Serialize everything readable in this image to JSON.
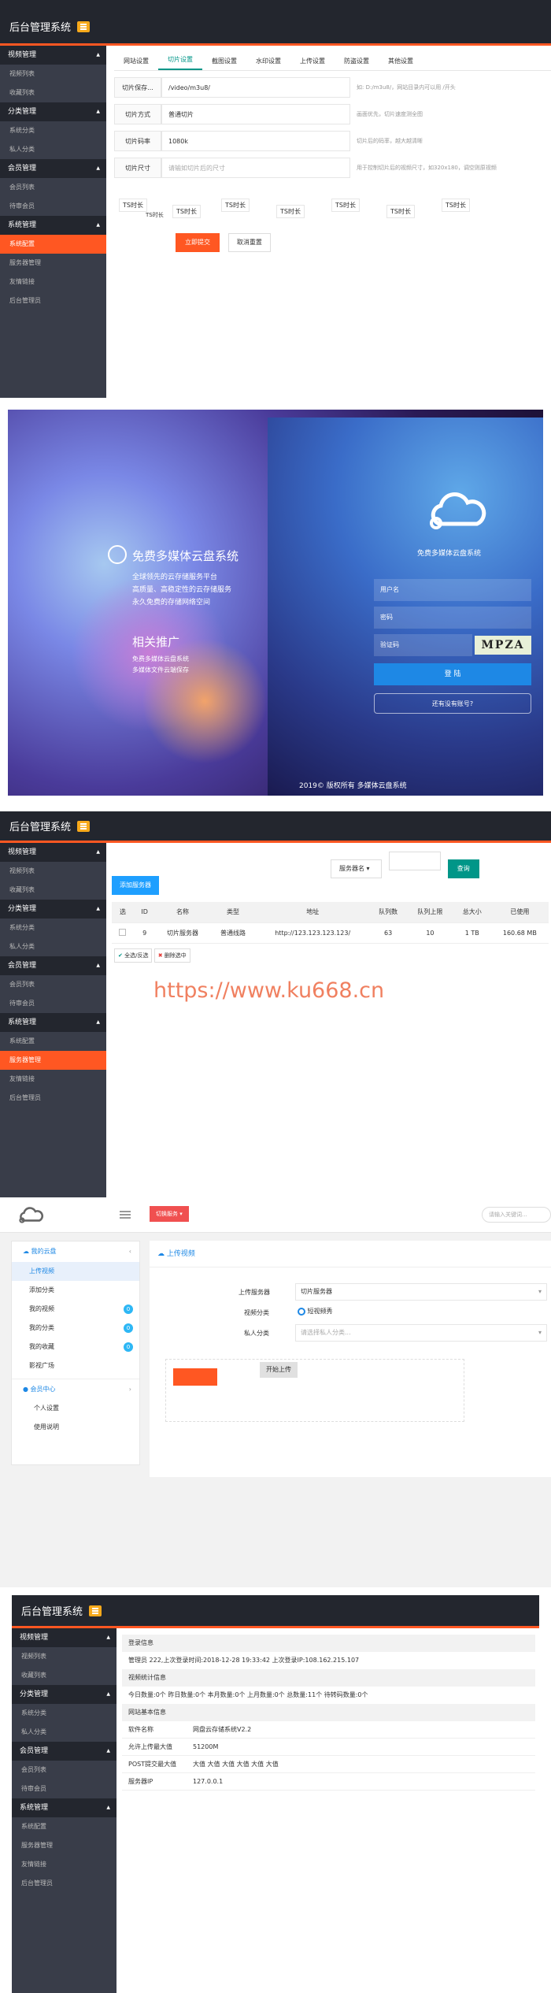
{
  "s1": {
    "title": "后台管理系统",
    "sidebar": [
      {
        "g": "视频管理",
        "items": [
          "视频列表",
          "收藏列表"
        ]
      },
      {
        "g": "分类管理",
        "items": [
          "系统分类",
          "私人分类"
        ]
      },
      {
        "g": "会员管理",
        "items": [
          "会员列表",
          "待审会员"
        ]
      },
      {
        "g": "系统管理",
        "items": [
          "系统配置",
          "服务器管理",
          "友情链接",
          "后台管理员"
        ]
      }
    ],
    "active_item": "系统配置",
    "tabs": [
      "网站设置",
      "切片设置",
      "截图设置",
      "水印设置",
      "上传设置",
      "防盗设置",
      "其他设置"
    ],
    "active_tab": "切片设置",
    "rows": [
      {
        "label": "切片保存...",
        "value": "/video/m3u8/",
        "hint": "如: D:/m3u8/，网站目录内可以用 /开头"
      },
      {
        "label": "切片方式",
        "value": "普通切片",
        "hint": "画面优先，切片速度测全图"
      },
      {
        "label": "切片码率",
        "value": "1080k",
        "hint": "切片后的码率，越大越清晰"
      },
      {
        "label": "切片尺寸",
        "value": "",
        "placeholder": "请输如切片后的尺寸",
        "hint": "用于控制切片后的视频尺寸，如320x180，调空则原视频"
      }
    ],
    "ts_labels": [
      "TS时长",
      "TS时长",
      "TS时长",
      "TS时长",
      "TS时长",
      "TS时长",
      "TS时长"
    ],
    "ts_top": "TS时长",
    "submit": "立即提交",
    "reset": "取消重置"
  },
  "s2": {
    "heading": "免费多媒体云盘系统",
    "lines": [
      "全球领先的云存储服务平台",
      "高质量、高稳定性的云存储服务",
      "永久免费的存储网络空间"
    ],
    "promo_title": "相关推广",
    "promo_lines": [
      "免费多媒体云盘系统",
      "多媒体文件云端保存"
    ],
    "panel_title": "免费多媒体云盘系统",
    "username": "用户名",
    "password": "密码",
    "captcha": "验证码",
    "captcha_code": "MPZA",
    "login": "登 陆",
    "register": "还有没有账号?",
    "footer": "2019© 版权所有 多媒体云盘系统"
  },
  "s3": {
    "title": "后台管理系统",
    "sidebar": [
      {
        "g": "视频管理",
        "items": [
          "视频列表",
          "收藏列表"
        ]
      },
      {
        "g": "分类管理",
        "items": [
          "系统分类",
          "私人分类"
        ]
      },
      {
        "g": "会员管理",
        "items": [
          "会员列表",
          "待审会员"
        ]
      },
      {
        "g": "系统管理",
        "items": [
          "系统配置",
          "服务器管理",
          "友情链接",
          "后台管理员"
        ]
      }
    ],
    "active_item": "服务器管理",
    "select": "服务器名",
    "query": "查询",
    "add": "添加服务器",
    "cols": [
      "选",
      "ID",
      "名称",
      "类型",
      "地址",
      "队列数",
      "队列上限",
      "总大小",
      "已使用"
    ],
    "row": [
      "",
      "9",
      "切片服务器",
      "普通线路",
      "http://123.123.123.123/",
      "63",
      "10",
      "1 TB",
      "160.68 MB"
    ],
    "select_all": "全选/反选",
    "delete": "删除选中",
    "watermark": "https://www.ku668.cn"
  },
  "s4": {
    "top_btn": "切换服务 ▾",
    "search": "请输入关键词...",
    "menu1": "我的云盘",
    "menu1_items": [
      "上传视频",
      "添加分类",
      "我的视频",
      "我的分类",
      "我的收藏",
      "影视广场"
    ],
    "badges": [
      "0",
      "0",
      "0"
    ],
    "menu2": "会员中心",
    "menu2_items": [
      "个人设置",
      "使用说明"
    ],
    "panel_title": "上传视频",
    "server_label": "上传服务器",
    "server_value": "切片服务器",
    "cat_label": "视频分类",
    "cat_value": "短视频秀",
    "private_label": "私人分类",
    "private_placeholder": "请选择私人分类...",
    "upload_btn": "开始上传"
  },
  "s5": {
    "title": "后台管理系统",
    "sidebar": [
      {
        "g": "视频管理",
        "items": [
          "视频列表",
          "收藏列表"
        ]
      },
      {
        "g": "分类管理",
        "items": [
          "系统分类",
          "私人分类"
        ]
      },
      {
        "g": "会员管理",
        "items": [
          "会员列表",
          "待审会员"
        ]
      },
      {
        "g": "系统管理",
        "items": [
          "系统配置",
          "服务器管理",
          "友情链接",
          "后台管理员"
        ]
      }
    ],
    "login_head": "登录信息",
    "login_text": "管理员 222,上次登录时间:2018-12-28 19:33:42 上次登录IP:108.162.215.107",
    "stat_head": "视频统计信息",
    "stat_text": "今日数量:0个 昨日数量:0个 本月数量:0个 上月数量:0个 总数量:11个 待转码数量:0个",
    "site_head": "网站基本信息",
    "info": [
      {
        "k": "软件名称",
        "v": "网盘云存储系统V2.2"
      },
      {
        "k": "允许上传最大值",
        "v": "51200M"
      },
      {
        "k": "POST提交最大值",
        "v": "大值 大值 大值 大值 大值 大值"
      },
      {
        "k": "服务器IP",
        "v": "127.0.0.1"
      }
    ]
  }
}
